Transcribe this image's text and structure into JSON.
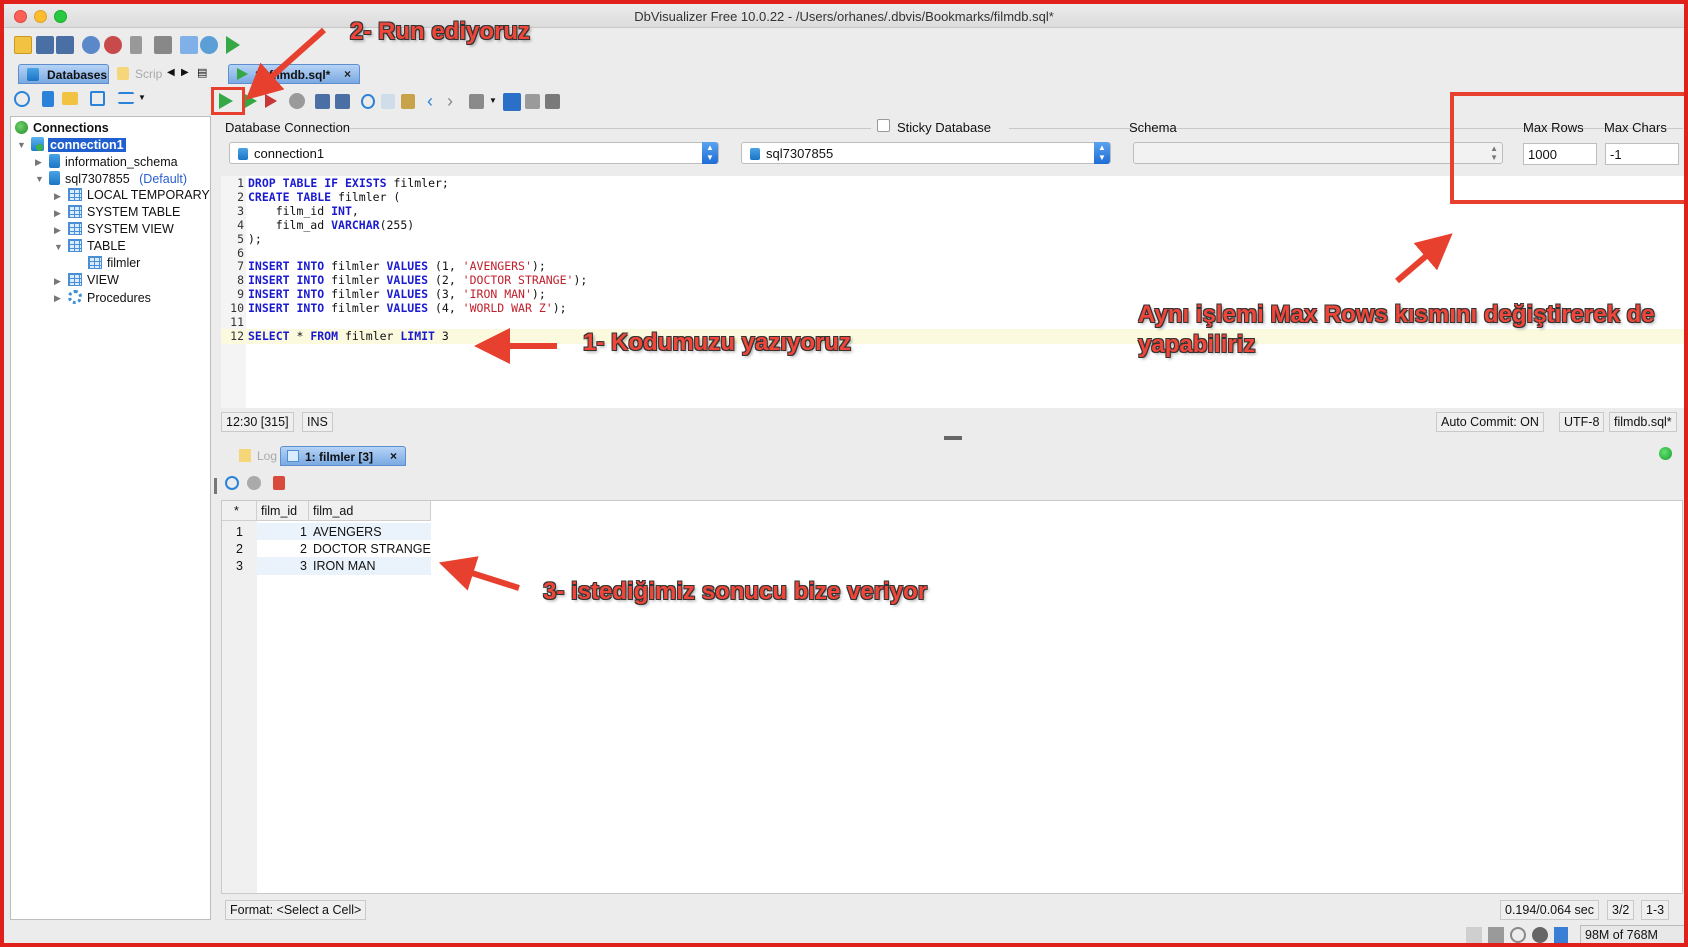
{
  "window": {
    "title": "DbVisualizer Free 10.0.22 - /Users/orhanes/.dbvis/Bookmarks/filmdb.sql*"
  },
  "left_panel": {
    "tabs": [
      {
        "label": "Databases",
        "active": true
      },
      {
        "label": "Scrip",
        "active": false
      }
    ],
    "tree": {
      "root": "Connections",
      "connection": "connection1",
      "schemas": [
        {
          "label": "information_schema"
        },
        {
          "label": "sql7307855",
          "badge": "(Default)"
        }
      ],
      "object_types": [
        {
          "label": "LOCAL TEMPORARY"
        },
        {
          "label": "SYSTEM TABLE"
        },
        {
          "label": "SYSTEM VIEW"
        },
        {
          "label": "TABLE",
          "children": [
            "filmler"
          ]
        },
        {
          "label": "VIEW"
        },
        {
          "label": "Procedures"
        }
      ]
    }
  },
  "editor_tab": {
    "label": "1: filmdb.sql*",
    "close": "×"
  },
  "connection_row": {
    "db_connection_label": "Database Connection",
    "db_connection_value": "connection1",
    "sticky_label": "Sticky Database",
    "sticky_checked": false,
    "database_value": "sql7307855",
    "schema_label": "Schema",
    "schema_value": "",
    "max_rows_label": "Max Rows",
    "max_rows_value": "1000",
    "max_chars_label": "Max Chars",
    "max_chars_value": "-1"
  },
  "editor": {
    "lines": [
      {
        "n": "1",
        "text": "DROP TABLE IF EXISTS filmler;"
      },
      {
        "n": "2",
        "text": "CREATE TABLE filmler ("
      },
      {
        "n": "3",
        "text": "    film_id INT,"
      },
      {
        "n": "4",
        "text": "    film_ad VARCHAR(255)"
      },
      {
        "n": "5",
        "text": ");"
      },
      {
        "n": "6",
        "text": ""
      },
      {
        "n": "7",
        "text": "INSERT INTO filmler VALUES (1, 'AVENGERS');"
      },
      {
        "n": "8",
        "text": "INSERT INTO filmler VALUES (2, 'DOCTOR STRANGE');"
      },
      {
        "n": "9",
        "text": "INSERT INTO filmler VALUES (3, 'IRON MAN');"
      },
      {
        "n": "10",
        "text": "INSERT INTO filmler VALUES (4, 'WORLD WAR Z');"
      },
      {
        "n": "11",
        "text": ""
      },
      {
        "n": "12",
        "text": "SELECT * FROM filmler LIMIT 3"
      }
    ],
    "active_line": 12
  },
  "editor_status": {
    "position": "12:30 [315]",
    "mode": "INS",
    "auto_commit": "Auto Commit: ON",
    "encoding": "UTF-8",
    "file": "filmdb.sql*"
  },
  "result_tabs": [
    {
      "label": "Log",
      "active": false
    },
    {
      "label": "1: filmler [3]",
      "active": true,
      "close": "×"
    }
  ],
  "grid": {
    "corner": "*",
    "columns": [
      "film_id",
      "film_ad"
    ],
    "rows": [
      {
        "num": "1",
        "film_id": "1",
        "film_ad": "AVENGERS"
      },
      {
        "num": "2",
        "film_id": "2",
        "film_ad": "DOCTOR STRANGE"
      },
      {
        "num": "3",
        "film_id": "3",
        "film_ad": "IRON MAN"
      }
    ]
  },
  "bottom_status": {
    "format": "Format: <Select a Cell>",
    "timing": "0.194/0.064 sec",
    "position": "3/2",
    "range": "1-3",
    "memory": "98M of 768M"
  },
  "annotations": {
    "step1": "1- Kodumuzu yazıyoruz",
    "step2": "2- Run ediyoruz",
    "step3": "3- istediğimiz sonucu bize veriyor",
    "note_line1": "Aynı işlemi Max Rows kısmını değiştirerek de",
    "note_line2": "yapabiliriz"
  },
  "colors": {
    "annotation": "#f0463a",
    "keyword": "#1a1ad0",
    "string": "#c0202d",
    "tab_active": "#7aa9e2"
  }
}
